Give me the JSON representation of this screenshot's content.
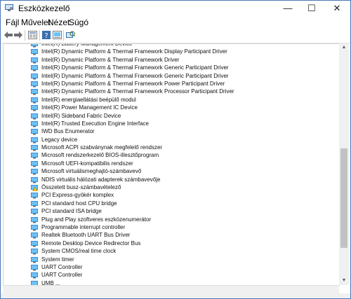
{
  "window": {
    "title": "Eszközkezelő",
    "controls": {
      "minimize": "—",
      "maximize": "☐",
      "close": "✕"
    }
  },
  "menu": [
    "Fájl",
    "Művelet",
    "Nézet",
    "Súgó"
  ],
  "toolbar_icons": [
    "back-arrow-icon",
    "forward-arrow-icon",
    "properties-icon",
    "update-driver-icon",
    "help-icon",
    "scan-hardware-icon"
  ],
  "devices": [
    "Intel(R) Battery Management Device",
    "Intel(R) Dynamic Platform & Thermal Framework Display Participant Driver",
    "Intel(R) Dynamic Platform & Thermal Framework Driver",
    "Intel(R) Dynamic Platform & Thermal Framework Generic Participant Driver",
    "Intel(R) Dynamic Platform & Thermal Framework Generic Participant Driver",
    "Intel(R) Dynamic Platform & Thermal Framework Power Participant Driver",
    "Intel(R) Dynamic Platform & Thermal Framework Processor Participant Driver",
    "Intel(R) energiaellátási beépülő modul",
    "Intel(R) Power Management IC Device",
    "Intel(R) Sideband Fabric Device",
    "Intel(R) Trusted Execution Engine Interface",
    "IWD Bus Enumerator",
    "Legacy device",
    "Microsoft ACPI szabványnak megfelelő rendszer",
    "Microsoft rendszerkezelő BIOS-illesztőprogram",
    "Microsoft UEFI-kompatibilis rendszer",
    "Microsoft virtuálismeghajtó-számbavevő",
    "NDIS virtuális hálózati adapterek számbavevője",
    "Összetett busz-számbavételező",
    "PCI Express-gyökér komplex",
    "PCI standard host CPU bridge",
    "PCI standard ISA bridge",
    "Plug and Play szoftveres eszközenumerátor",
    "Programmable interrupt controller",
    "Realtek Bluetooth UART Bus Driver",
    "Remote Desktop Device Redirector Bus",
    "System CMOS/real time clock",
    "System timer",
    "UART Controller",
    "UART Controller",
    "UMB ..."
  ],
  "colors": {
    "device_icon": "#3a8fd8",
    "device_icon_screen": "#6ec1f5",
    "title_border": "#4a78b8"
  }
}
